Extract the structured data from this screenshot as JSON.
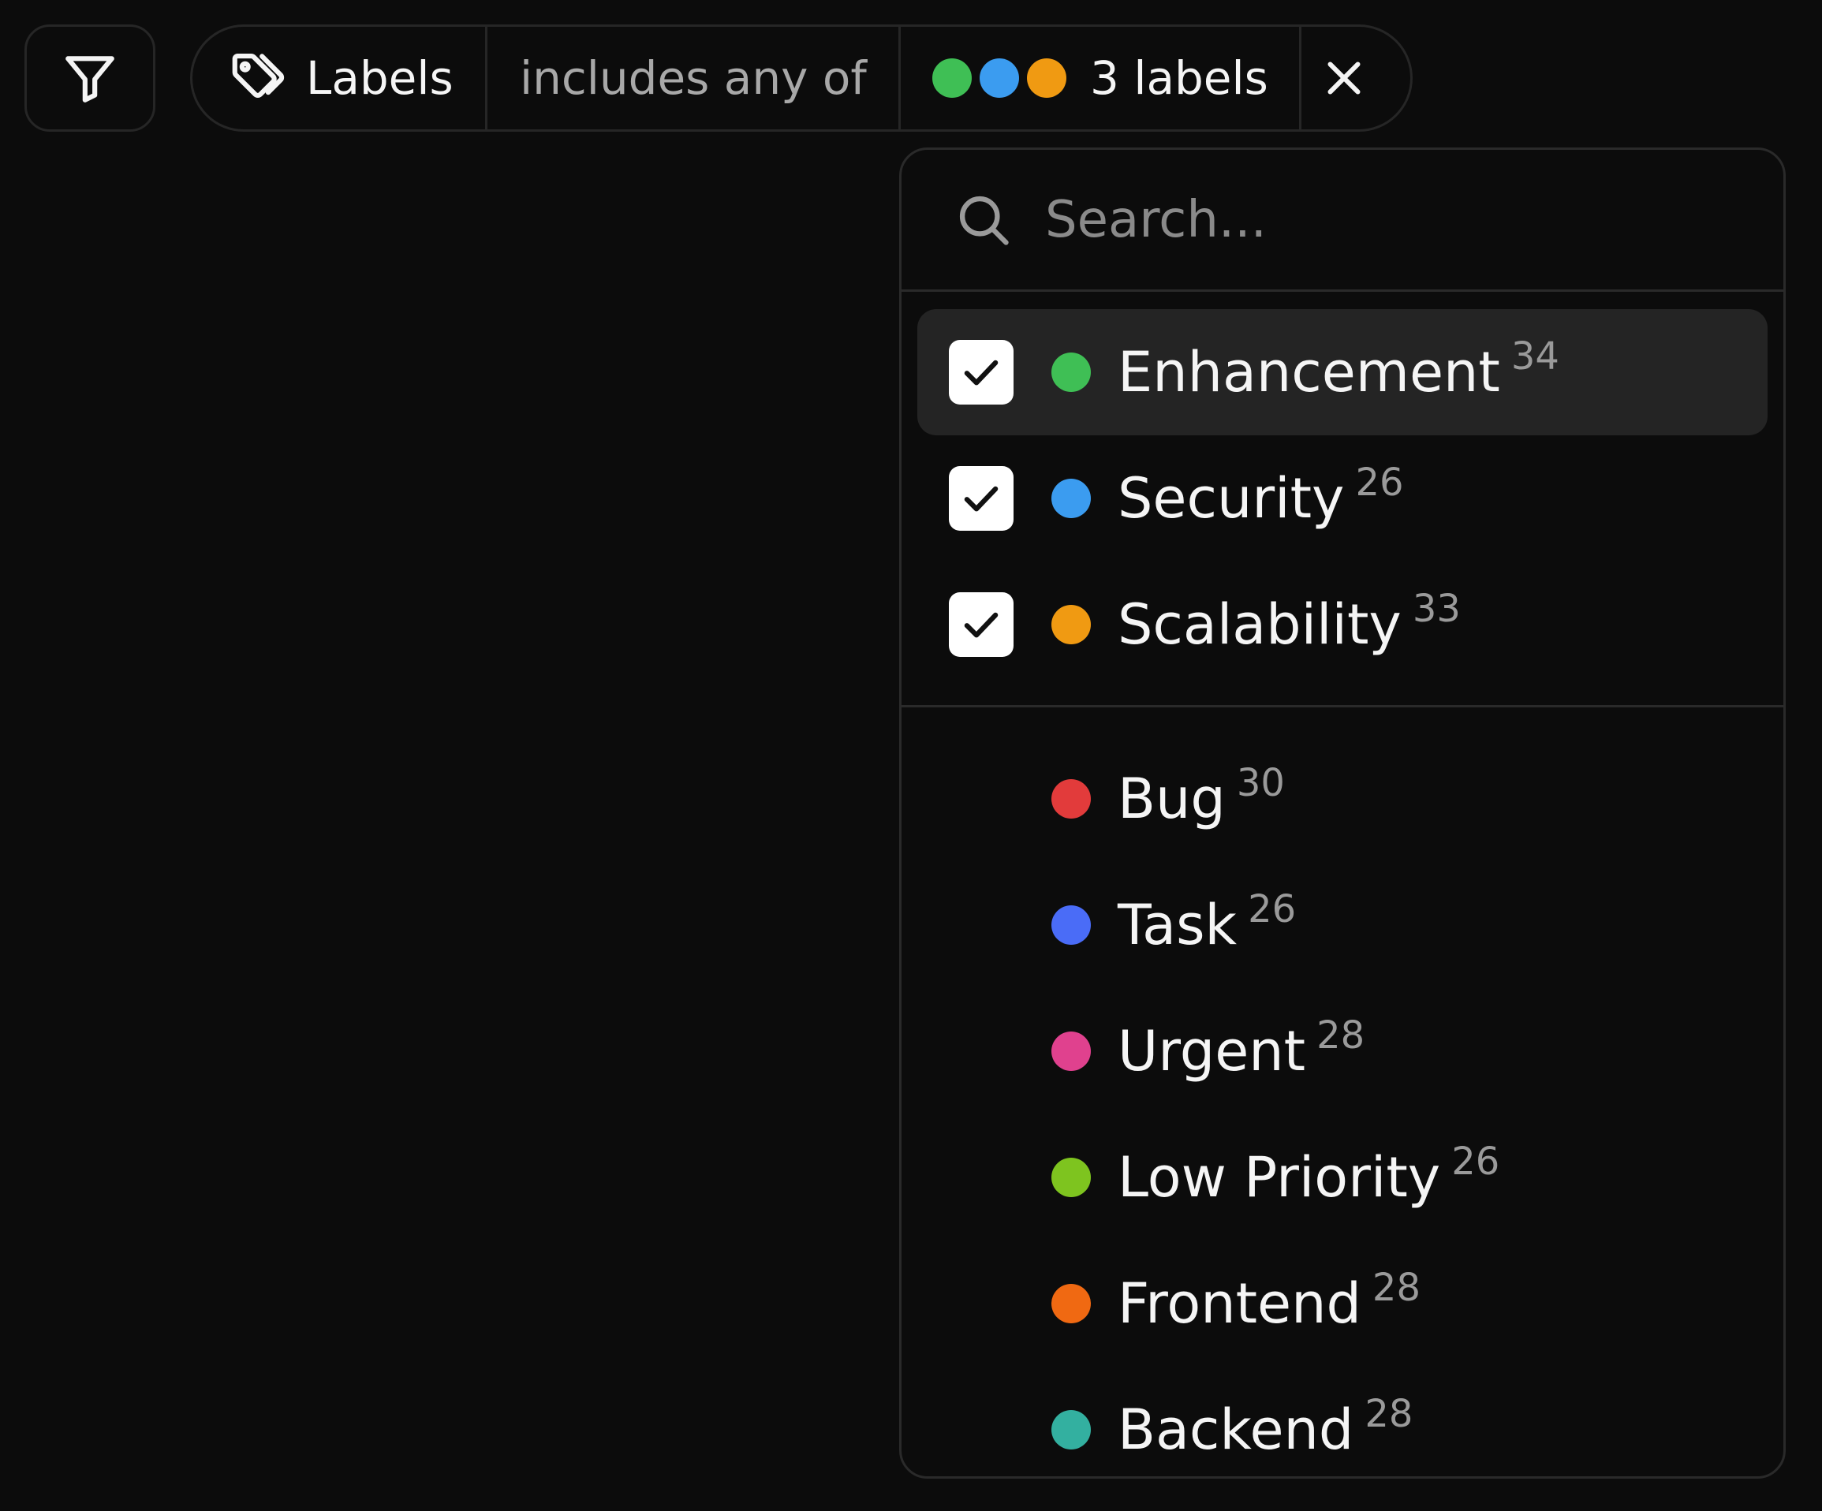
{
  "filter_button": {
    "icon": "funnel-icon"
  },
  "chip": {
    "field_label": "Labels",
    "field_icon": "tags-icon",
    "operator_label": "includes any of",
    "value_label": "3 labels",
    "value_dots": [
      "#3fbf55",
      "#3b9cf0",
      "#f09a12"
    ],
    "clear_icon": "close-icon"
  },
  "search": {
    "placeholder": "Search...",
    "value": ""
  },
  "selected_options": [
    {
      "label": "Enhancement",
      "count": "34",
      "color": "#3fbf55",
      "checked": true
    },
    {
      "label": "Security",
      "count": "26",
      "color": "#3b9cf0",
      "checked": true
    },
    {
      "label": "Scalability",
      "count": "33",
      "color": "#f09a12",
      "checked": true
    }
  ],
  "other_options": [
    {
      "label": "Bug",
      "count": "30",
      "color": "#e23b3b",
      "checked": false
    },
    {
      "label": "Task",
      "count": "26",
      "color": "#4a6cf7",
      "checked": false
    },
    {
      "label": "Urgent",
      "count": "28",
      "color": "#e0418e",
      "checked": false
    },
    {
      "label": "Low Priority",
      "count": "26",
      "color": "#7ec41f",
      "checked": false
    },
    {
      "label": "Frontend",
      "count": "28",
      "color": "#f06912",
      "checked": false
    },
    {
      "label": "Backend",
      "count": "28",
      "color": "#33b0a0",
      "checked": false
    }
  ]
}
